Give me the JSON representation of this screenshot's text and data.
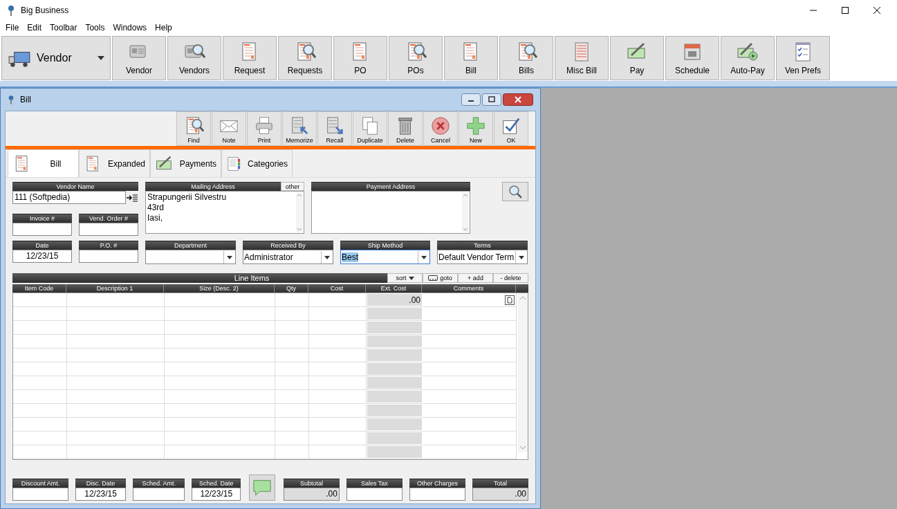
{
  "window": {
    "title": "Big Business"
  },
  "menu": [
    "File",
    "Edit",
    "Toolbar",
    "Tools",
    "Windows",
    "Help"
  ],
  "toolbar": {
    "selector": "Vendor",
    "buttons": [
      "Vendor",
      "Vendors",
      "Request",
      "Requests",
      "PO",
      "POs",
      "Bill",
      "Bills",
      "Misc Bill",
      "Pay",
      "Schedule",
      "Auto-Pay",
      "Ven Prefs"
    ]
  },
  "bill_window": {
    "title": "Bill",
    "actions": [
      "Find",
      "Note",
      "Print",
      "Memorize",
      "Recall",
      "Duplicate",
      "Delete",
      "Cancel",
      "New",
      "OK"
    ],
    "tabs": [
      {
        "label": "Bill",
        "selected": true
      },
      {
        "label": "Expanded",
        "selected": false
      },
      {
        "label": "Payments",
        "selected": false
      },
      {
        "label": "Categories",
        "selected": false
      }
    ],
    "vendor_name": {
      "label": "Vendor Name",
      "value": "111 (Softpedia)"
    },
    "mailing_address": {
      "label": "Mailing Address",
      "other": "other",
      "lines": [
        "Strapungerii Silvestru",
        "43rd",
        "Iasi,"
      ]
    },
    "payment_address": {
      "label": "Payment Address"
    },
    "small_fields": [
      {
        "label": "Invoice #"
      },
      {
        "label": "Vend. Order #"
      }
    ],
    "fields": [
      {
        "label": "Date",
        "value": "12/23/15",
        "kind": "text",
        "text_selected": false
      },
      {
        "label": "P.O. #",
        "kind": "text",
        "text_selected": false
      },
      {
        "label": "Department",
        "kind": "dropdown",
        "text_selected": false
      },
      {
        "label": "Received By",
        "value": "Administrator",
        "kind": "dropdown",
        "text_selected": false
      },
      {
        "label": "Ship Method",
        "value": "Best",
        "kind": "dropdown",
        "text_selected": true
      },
      {
        "label": "Terms",
        "value": "Default Vendor Term",
        "kind": "dropdown",
        "text_selected": false
      }
    ],
    "line_items": {
      "title": "Line Items",
      "controls": [
        {
          "label": "sort",
          "kind": "dropdown"
        },
        {
          "label": "goto",
          "kind": "goto"
        },
        {
          "label": "+ add",
          "kind": "plain"
        },
        {
          "label": "- delete",
          "kind": "plain"
        }
      ],
      "columns": [
        "Item Code",
        "Description 1",
        "Size (Desc. 2)",
        "Qty",
        "Cost",
        "Ext. Cost",
        "Comments"
      ],
      "rows": [
        {
          "ext_cost": ".00"
        }
      ]
    },
    "footer_left": [
      {
        "label": "Discount Amt.",
        "kind": "input"
      },
      {
        "label": "Disc. Date",
        "value": "12/23/15",
        "kind": "input"
      },
      {
        "label": "Sched. Amt.",
        "kind": "input"
      },
      {
        "label": "Sched. Date",
        "value": "12/23/15",
        "kind": "input"
      }
    ],
    "footer_right": [
      {
        "label": "Subtotal",
        "value": ".00",
        "kind": "readonly"
      },
      {
        "label": "Sales Tax",
        "kind": "input"
      },
      {
        "label": "Other Charges",
        "kind": "input"
      },
      {
        "label": "Total",
        "value": ".00",
        "kind": "readonly"
      }
    ]
  }
}
